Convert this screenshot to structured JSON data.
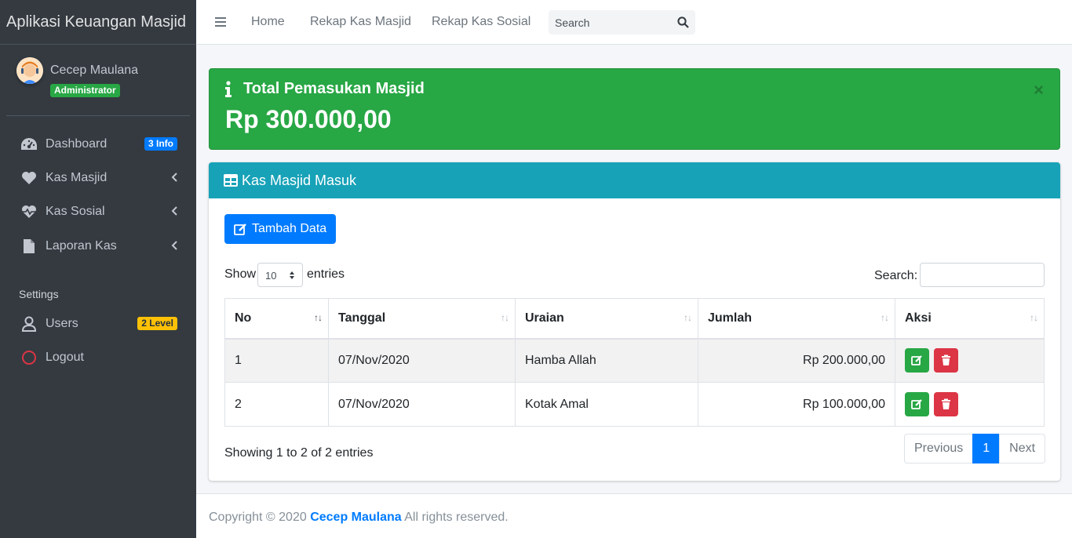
{
  "sidebar": {
    "brand": "Aplikasi Keuangan Masjid",
    "user": {
      "name": "Cecep Maulana",
      "role": "Administrator"
    },
    "items": [
      {
        "label": "Dashboard",
        "icon": "tachometer-icon",
        "badge": "3 Info"
      },
      {
        "label": "Kas Masjid",
        "icon": "heart-icon"
      },
      {
        "label": "Kas Sosial",
        "icon": "heartbeat-icon"
      },
      {
        "label": "Laporan Kas",
        "icon": "file-icon"
      }
    ],
    "settings_header": "Settings",
    "settings_items": [
      {
        "label": "Users",
        "icon": "user-icon",
        "badge": "2 Level"
      },
      {
        "label": "Logout",
        "icon": "circle-icon"
      }
    ]
  },
  "topbar": {
    "links": [
      "Home",
      "Rekap Kas Masjid",
      "Rekap Kas Sosial"
    ],
    "search_placeholder": "Search"
  },
  "alert": {
    "title": "Total Pemasukan Masjid",
    "amount": "Rp 300.000,00",
    "close": "×"
  },
  "card": {
    "title": "Kas Masjid Masuk",
    "add_button": "Tambah Data",
    "show_label": "Show",
    "entries_value": "10",
    "entries_label": "entries",
    "search_label": "Search:",
    "columns": [
      "No",
      "Tanggal",
      "Uraian",
      "Jumlah",
      "Aksi"
    ],
    "rows": [
      {
        "no": "1",
        "tanggal": "07/Nov/2020",
        "uraian": "Hamba Allah",
        "jumlah": "Rp 200.000,00"
      },
      {
        "no": "2",
        "tanggal": "07/Nov/2020",
        "uraian": "Kotak Amal",
        "jumlah": "Rp 100.000,00"
      }
    ],
    "info": "Showing 1 to 2 of 2 entries",
    "pagination": {
      "previous": "Previous",
      "current": "1",
      "next": "Next"
    }
  },
  "footer": {
    "prefix": "Copyright © 2020",
    "author": "Cecep Maulana",
    "suffix": "All rights reserved."
  }
}
